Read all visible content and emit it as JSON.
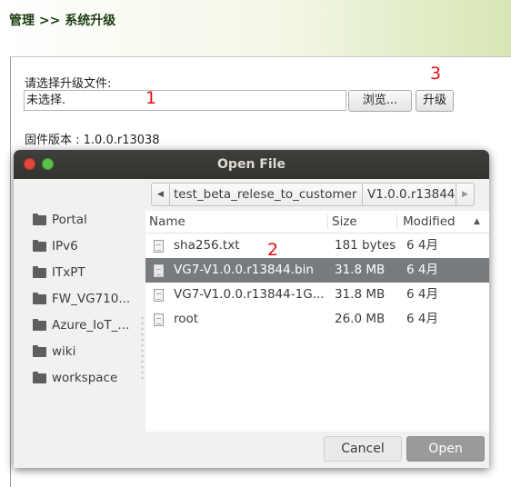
{
  "page": {
    "breadcrumb": "管理 >> 系统升级",
    "select_label": "请选择升级文件:",
    "file_field_value": "未选择.",
    "browse_label": "浏览...",
    "upgrade_label": "升级",
    "firmware_version": "固件版本 : 1.0.0.r13038"
  },
  "annotations": {
    "a1": "1",
    "a2": "2",
    "a3": "3",
    "color": "#e01010"
  },
  "dialog": {
    "title": "Open File",
    "path_left_arrow": "◀",
    "path_right_arrow": "▶",
    "path_segments": [
      "test_beta_relese_to_customer",
      "V1.0.0.r13844"
    ],
    "sidebar": [
      "Portal",
      "IPv6",
      "ITxPT",
      "FW_VG710...",
      "Azure_IoT_...",
      "wiki",
      "workspace"
    ],
    "columns": {
      "name": "Name",
      "size": "Size",
      "modified": "Modified",
      "sort_indicator": "▲"
    },
    "files": [
      {
        "name": "sha256.txt",
        "size": "181 bytes",
        "modified": "6 4月"
      },
      {
        "name": "VG7-V1.0.0.r13844.bin",
        "size": "31.8 MB",
        "modified": "6 4月",
        "selected": true
      },
      {
        "name": "VG7-V1.0.0.r13844-1G...",
        "size": "31.8 MB",
        "modified": "6 4月"
      },
      {
        "name": "root",
        "size": "26.0 MB",
        "modified": "6 4月"
      }
    ],
    "cancel_label": "Cancel",
    "open_label": "Open"
  },
  "colors": {
    "selected_row": "#777b80",
    "titlebar": "#3a3a37",
    "close_button": "#e2493a",
    "maximize_button": "#5bbf4b",
    "header_green": "#d7e6b4"
  },
  "icons": {
    "folder": "folder-icon",
    "file": "document-icon",
    "close": "close-icon",
    "maximize": "maximize-icon"
  }
}
